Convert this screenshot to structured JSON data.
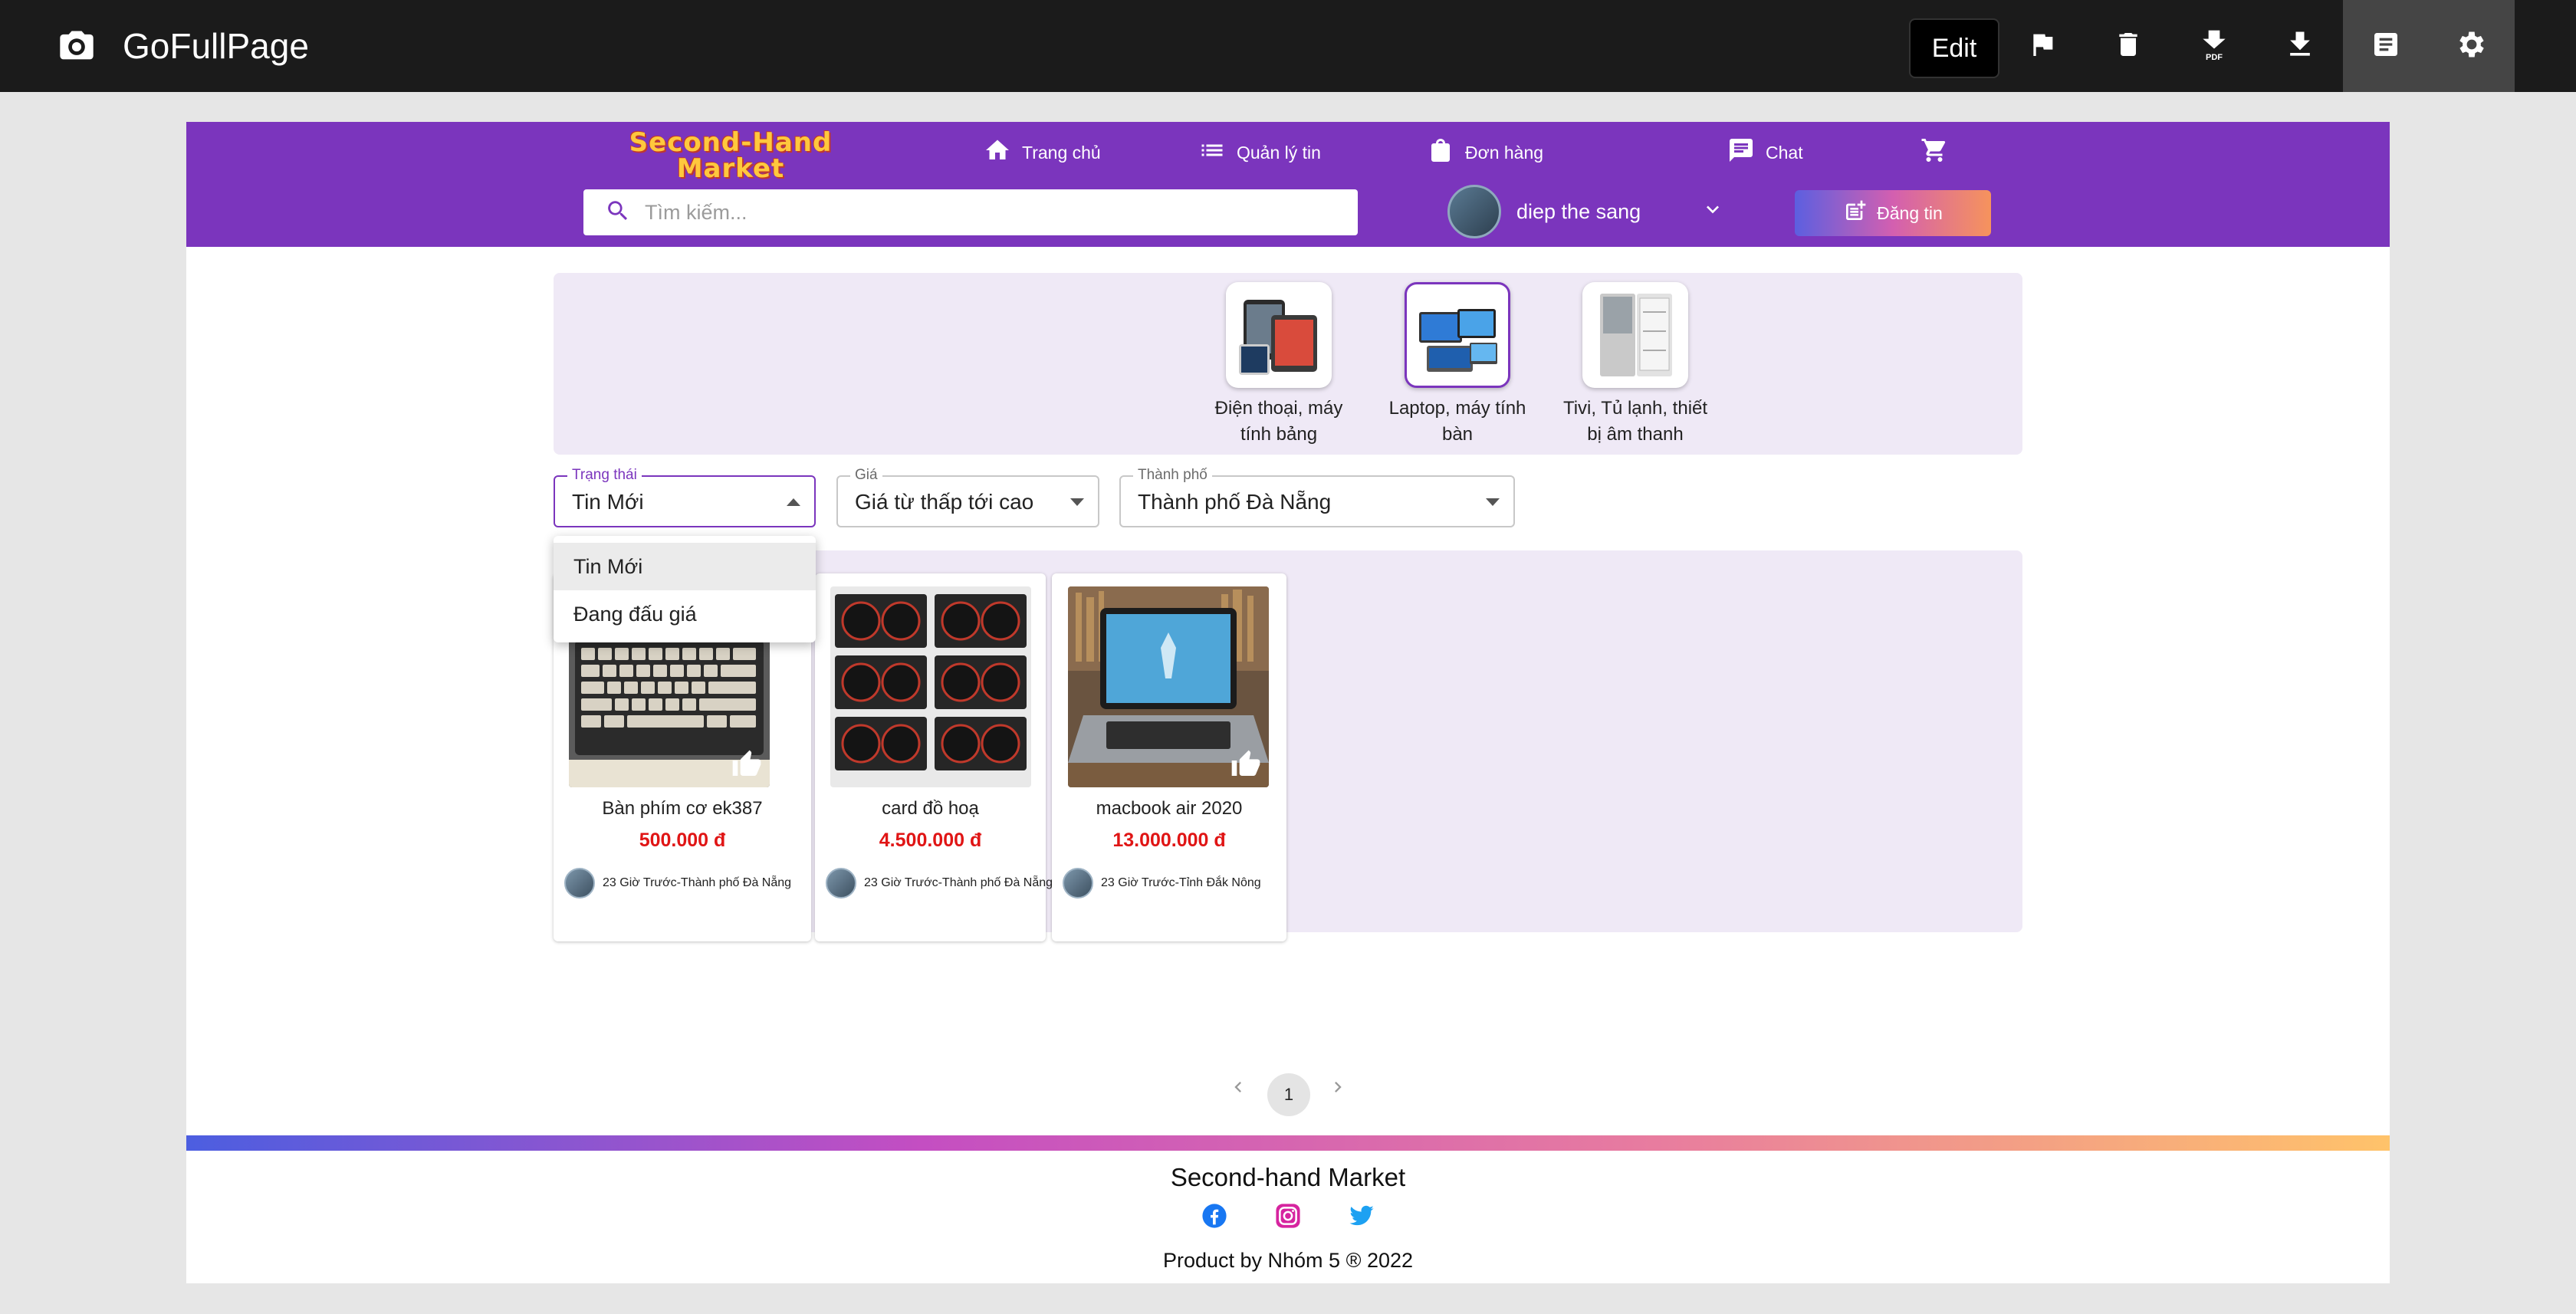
{
  "extension": {
    "title": "GoFullPage",
    "edit_label": "Edit",
    "toolbar_icons": [
      "flag-icon",
      "trash-icon",
      "pdf-download-icon",
      "download-icon",
      "document-icon",
      "gear-icon"
    ]
  },
  "site": {
    "brand": "Second-Hand Market",
    "nav": [
      {
        "label": "Trang chủ",
        "icon": "home-icon"
      },
      {
        "label": "Quản lý tin",
        "icon": "list-icon"
      },
      {
        "label": "Đơn hàng",
        "icon": "bag-icon"
      },
      {
        "label": "Chat",
        "icon": "chat-icon"
      }
    ],
    "search_placeholder": "Tìm kiếm...",
    "user_name": "diep the sang",
    "post_label": "Đăng tin",
    "accent": "#7b35bd"
  },
  "categories": [
    {
      "label": "Điện thoại, máy tính bảng",
      "selected": false
    },
    {
      "label": "Laptop, máy tính bàn",
      "selected": true
    },
    {
      "label": "Tivi, Tủ lạnh, thiết bị âm thanh",
      "selected": false
    }
  ],
  "filters": {
    "status": {
      "label": "Trạng thái",
      "value": "Tin Mới"
    },
    "price": {
      "label": "Giá",
      "value": "Giá từ thấp tới cao"
    },
    "city": {
      "label": "Thành phố",
      "value": "Thành phố Đà Nẵng"
    }
  },
  "status_menu": [
    "Tin Mới",
    "Đang đấu giá"
  ],
  "products": [
    {
      "name": "Bàn phím cơ ek387",
      "price": "500.000 đ",
      "meta": "23 Giờ Trước-Thành phố Đà Nẵng"
    },
    {
      "name": "card đồ hoạ",
      "price": "4.500.000 đ",
      "meta": "23 Giờ Trước-Thành phố Đà Nẵng"
    },
    {
      "name": "macbook air 2020",
      "price": "13.000.000 đ",
      "meta": "23 Giờ Trước-Tỉnh Đắk Nông"
    }
  ],
  "pagination": {
    "current": "1"
  },
  "footer": {
    "title": "Second-hand Market",
    "credit": "Product by Nhóm 5 ® 2022",
    "social": [
      "facebook-icon",
      "instagram-icon",
      "twitter-icon"
    ]
  }
}
